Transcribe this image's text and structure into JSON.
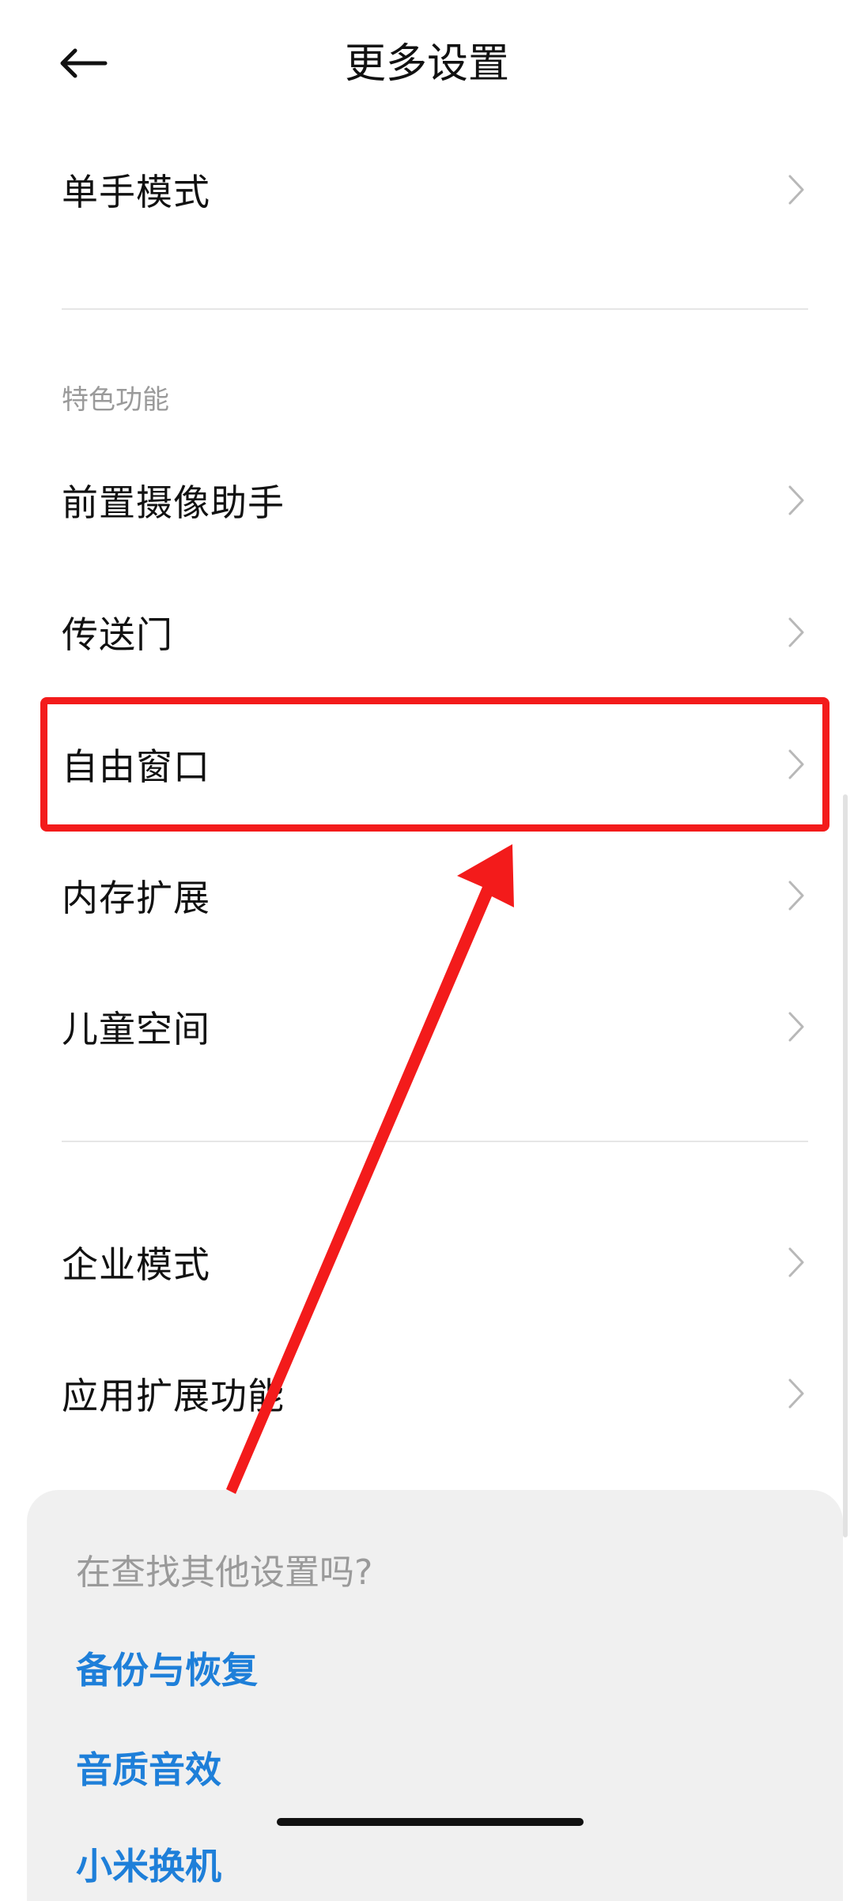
{
  "header": {
    "title": "更多设置",
    "back_icon": "arrow-left-icon"
  },
  "items_top": [
    {
      "label": "单手模式"
    }
  ],
  "section": {
    "header": "特色功能",
    "items": [
      {
        "label": "前置摄像助手"
      },
      {
        "label": "传送门"
      },
      {
        "label": "自由窗口"
      },
      {
        "label": "内存扩展"
      },
      {
        "label": "儿童空间"
      }
    ]
  },
  "items_bottom": [
    {
      "label": "企业模式"
    },
    {
      "label": "应用扩展功能"
    }
  ],
  "bottom_card": {
    "prompt": "在查找其他设置吗?",
    "links": [
      {
        "label": "备份与恢复"
      },
      {
        "label": "音质音效"
      },
      {
        "label": "小米换机"
      }
    ]
  },
  "colors": {
    "annotation_red": "#f31b1b",
    "link_blue": "#1e7fd9",
    "section_gray": "#9a9a9a",
    "card_bg": "#f0f0f0"
  }
}
